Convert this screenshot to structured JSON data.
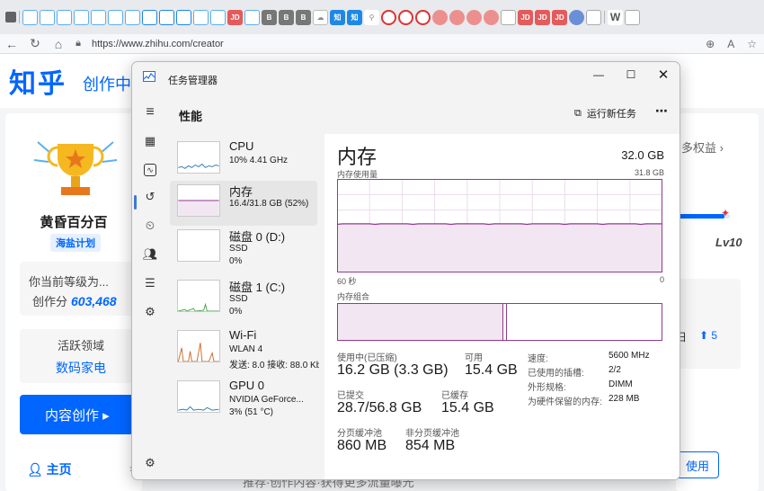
{
  "browser": {
    "url": "https://www.zhihu.com/creator"
  },
  "zhihu": {
    "logo": "知乎",
    "section": "创作中",
    "user_name": "黄昏百分百",
    "badge": "海盐计划",
    "level_text": "你当前等级为...",
    "score_label": "创作分",
    "score_value": "603,468",
    "domain_label": "活跃领域",
    "domain_value": "数码家电",
    "create_button": "内容创作 ▸",
    "home_label": "主页",
    "more_rights": "多权益 ›",
    "level_badge": "Lv10",
    "promo_text": "日",
    "promo_num": "⬆ 5",
    "use_button": "使用",
    "bottom_text": "推荐·创作内容·获得更多流量曝光",
    "level_progress": 0.9,
    "accent": "#0066ff"
  },
  "taskmgr": {
    "window_title": "任务管理器",
    "page_title": "性能",
    "run_new_task": "运行新任务",
    "more": "⋯",
    "devices": [
      {
        "name": "CPU",
        "sub1": "10% 4.41 GHz",
        "sub2": "",
        "sub3": ""
      },
      {
        "name": "内存",
        "sub1": "16.4/31.8 GB (52%)",
        "sub2": "",
        "sub3": ""
      },
      {
        "name": "磁盘 0 (D:)",
        "sub1": "SSD",
        "sub2": "0%",
        "sub3": ""
      },
      {
        "name": "磁盘 1 (C:)",
        "sub1": "SSD",
        "sub2": "0%",
        "sub3": ""
      },
      {
        "name": "Wi-Fi",
        "sub1": "WLAN 4",
        "sub2": "发送: 8.0 接收: 88.0 Kb",
        "sub3": ""
      },
      {
        "name": "GPU 0",
        "sub1": "NVIDIA GeForce...",
        "sub2": "3% (51 °C)",
        "sub3": ""
      }
    ],
    "memory": {
      "title": "内存",
      "total": "32.0 GB",
      "usage_label": "内存使用量",
      "usage_max": "31.8 GB",
      "time_left": "60 秒",
      "time_right": "0",
      "composition_label": "内存组合",
      "usage_fraction": 0.52,
      "in_use_fraction": 0.51,
      "stats": {
        "in_use_label": "使用中(已压缩)",
        "in_use_value": "16.2 GB (3.3 GB)",
        "available_label": "可用",
        "available_value": "15.4 GB",
        "committed_label": "已提交",
        "committed_value": "28.7/56.8 GB",
        "cached_label": "已缓存",
        "cached_value": "15.4 GB",
        "paged_label": "分页缓冲池",
        "paged_value": "860 MB",
        "nonpaged_label": "非分页缓冲池",
        "nonpaged_value": "854 MB"
      },
      "specs": [
        {
          "k": "速度:",
          "v": "5600 MHz"
        },
        {
          "k": "已使用的插槽:",
          "v": "2/2"
        },
        {
          "k": "外形规格:",
          "v": "DIMM"
        },
        {
          "k": "为硬件保留的内存:",
          "v": "228 MB"
        }
      ],
      "line_color": "#8e3b8e",
      "fill_color": "#f1e6f1"
    }
  }
}
